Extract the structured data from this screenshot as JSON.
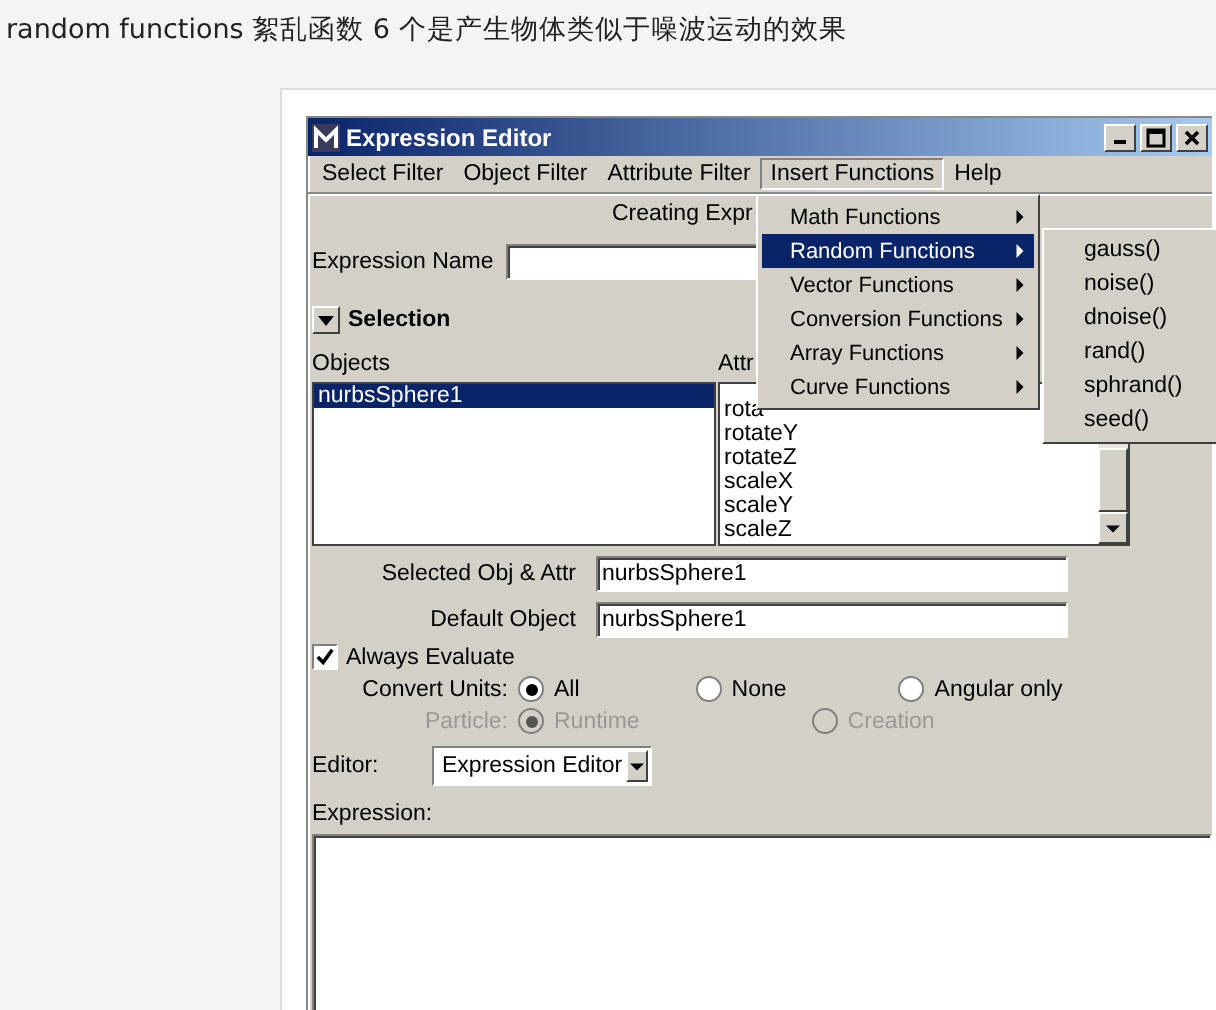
{
  "caption": "random functions 絮乱函数 6 个是产生物体类似于噪波运动的效果",
  "window": {
    "title": "Expression Editor"
  },
  "menu_bar": [
    {
      "label": "Select Filter",
      "selected": false
    },
    {
      "label": "Object Filter",
      "selected": false
    },
    {
      "label": "Attribute Filter",
      "selected": false
    },
    {
      "label": "Insert Functions",
      "selected": true
    },
    {
      "label": "Help",
      "selected": false
    }
  ],
  "open_menu": [
    {
      "label": "Math Functions",
      "selected": false
    },
    {
      "label": "Random Functions",
      "selected": true
    },
    {
      "label": "Vector Functions",
      "selected": false
    },
    {
      "label": "Conversion Functions",
      "selected": false
    },
    {
      "label": "Array Functions",
      "selected": false
    },
    {
      "label": "Curve Functions",
      "selected": false
    }
  ],
  "submenu": [
    "gauss()",
    "noise()",
    "dnoise()",
    "rand()",
    "sphrand()",
    "seed()"
  ],
  "heading": "Creating Expr",
  "expression_name": {
    "label": "Expression Name"
  },
  "selection": {
    "title": "Selection",
    "expanded": true,
    "objects_label": "Objects",
    "attributes_label": "Attr",
    "objects": [
      {
        "label": "nurbsSphere1",
        "selected": true
      }
    ],
    "attributes": [
      {
        "label": "rota",
        "selected": false
      },
      {
        "label": "rotateY",
        "selected": false
      },
      {
        "label": "rotateZ",
        "selected": false
      },
      {
        "label": "scaleX",
        "selected": false
      },
      {
        "label": "scaleY",
        "selected": false
      },
      {
        "label": "scaleZ",
        "selected": false
      }
    ]
  },
  "fields": [
    {
      "label": "Selected Obj & Attr",
      "value": "nurbsSphere1"
    },
    {
      "label": "Default Object",
      "value": "nurbsSphere1"
    }
  ],
  "always_evaluate": {
    "label": "Always Evaluate",
    "checked": true
  },
  "convert_units": {
    "label": "Convert Units:",
    "disabled": false,
    "options": [
      {
        "label": "All",
        "selected": true
      },
      {
        "label": "None",
        "selected": false
      },
      {
        "label": "Angular only",
        "selected": false
      }
    ]
  },
  "particle": {
    "label": "Particle:",
    "disabled": true,
    "options": [
      {
        "label": "Runtime",
        "selected": true
      },
      {
        "label": "Creation",
        "selected": false
      }
    ]
  },
  "editor": {
    "label": "Editor:",
    "value": "Expression Editor"
  },
  "expression": {
    "label": "Expression:"
  }
}
